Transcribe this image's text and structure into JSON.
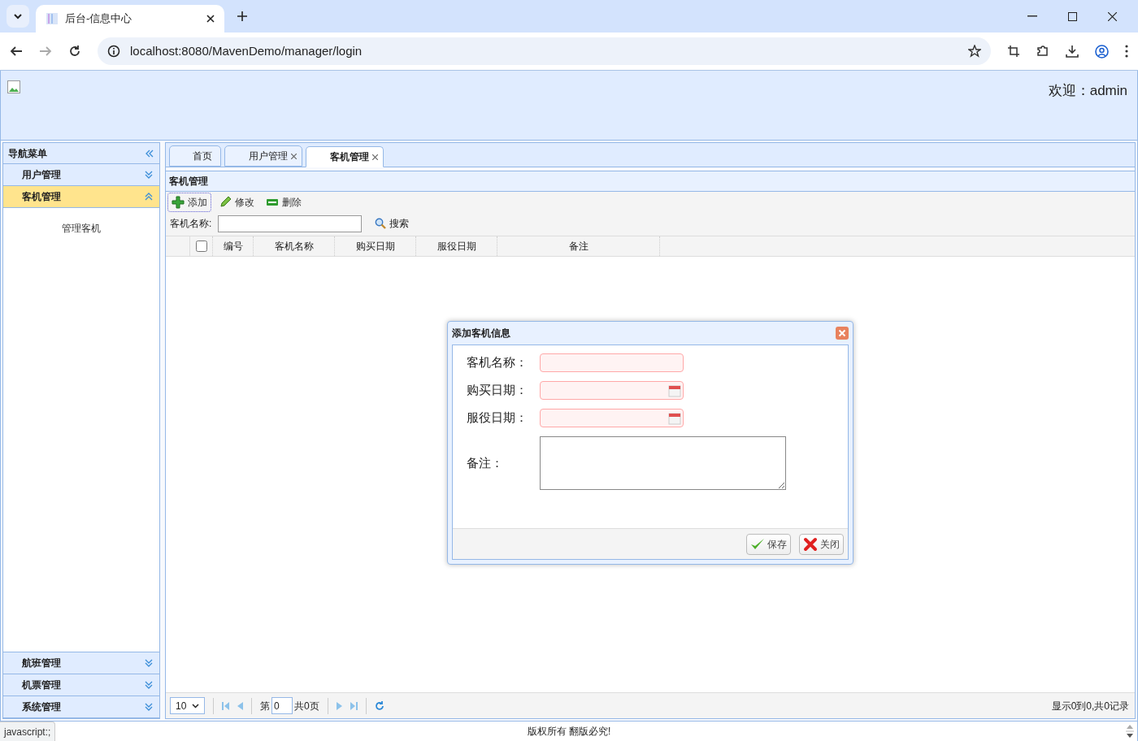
{
  "browser": {
    "tab_title": "后台-信息中心",
    "url": "localhost:8080/MavenDemo/manager/login"
  },
  "header": {
    "welcome": "欢迎：admin"
  },
  "nav": {
    "title": "导航菜单",
    "sections": [
      {
        "label": "用户管理",
        "expanded": false,
        "selected": false
      },
      {
        "label": "客机管理",
        "expanded": true,
        "selected": true,
        "items": [
          "管理客机"
        ]
      },
      {
        "label": "航班管理",
        "expanded": false,
        "selected": false
      },
      {
        "label": "机票管理",
        "expanded": false,
        "selected": false
      },
      {
        "label": "系统管理",
        "expanded": false,
        "selected": false
      }
    ]
  },
  "tabs": [
    {
      "label": "首页",
      "closable": false,
      "selected": false
    },
    {
      "label": "用户管理",
      "closable": true,
      "selected": false
    },
    {
      "label": "客机管理",
      "closable": true,
      "selected": true
    }
  ],
  "panel": {
    "title": "客机管理",
    "toolbar": [
      {
        "label": "添加",
        "kind": "add",
        "focused": true
      },
      {
        "label": "修改",
        "kind": "edit",
        "focused": false
      },
      {
        "label": "删除",
        "kind": "delete",
        "focused": false
      }
    ],
    "search": {
      "label": "客机名称:",
      "button": "搜索"
    },
    "table": {
      "checked": false,
      "columns": [
        "编号",
        "客机名称",
        "购买日期",
        "服役日期",
        "备注"
      ]
    },
    "pager": {
      "page_size": "10",
      "page_prefix": "第",
      "page_value": "0",
      "page_total": "共0页",
      "summary": "显示0到0,共0记录"
    }
  },
  "dialog": {
    "title": "添加客机信息",
    "fields": [
      {
        "label": "客机名称：",
        "kind": "text",
        "invalid": true
      },
      {
        "label": "购买日期：",
        "kind": "date",
        "invalid": true
      },
      {
        "label": "服役日期：",
        "kind": "date",
        "invalid": true
      },
      {
        "label": "备注：",
        "kind": "textarea",
        "invalid": false
      }
    ],
    "buttons": [
      {
        "label": "保存",
        "kind": "save"
      },
      {
        "label": "关闭",
        "kind": "close"
      }
    ]
  },
  "footer": "版权所有 翻版必究!",
  "status_url": "javascript:;"
}
